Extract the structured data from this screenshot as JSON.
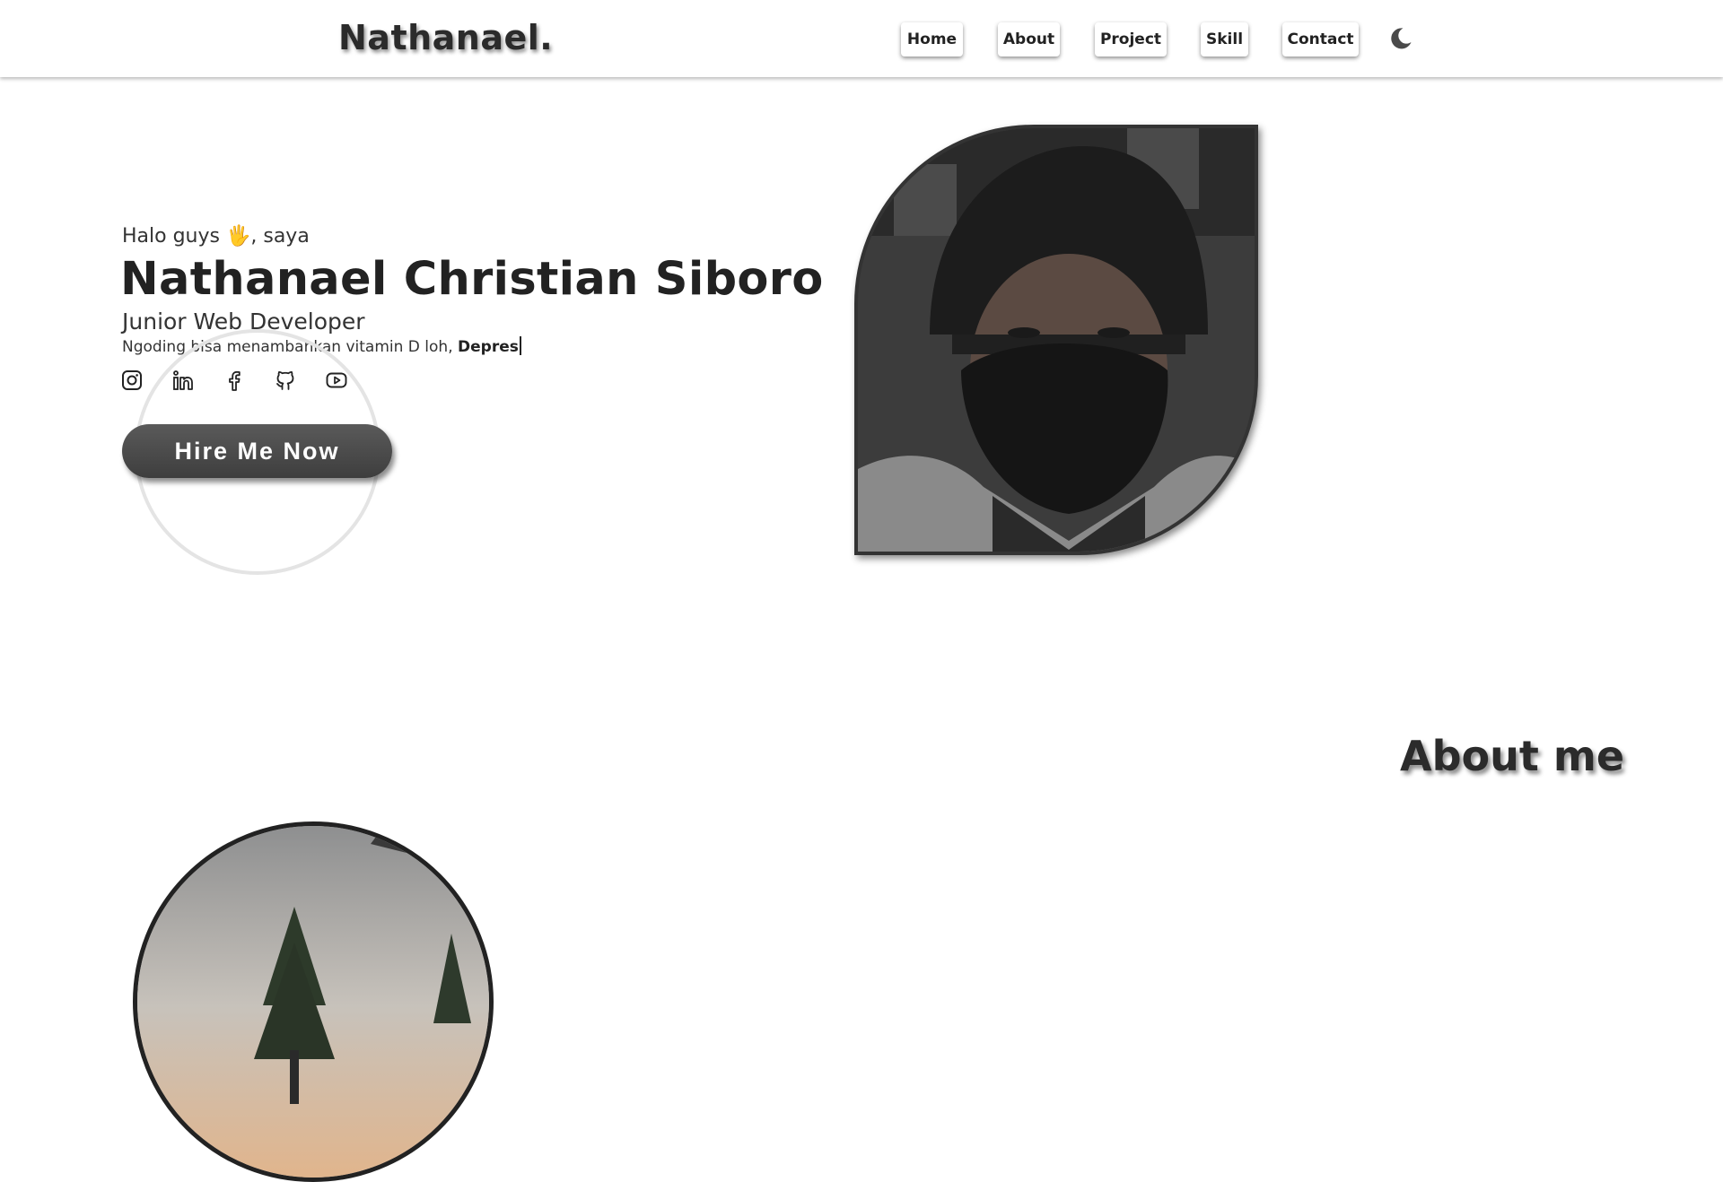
{
  "navbar": {
    "brand": "Nathanael.",
    "links": [
      {
        "label": "Home"
      },
      {
        "label": "About"
      },
      {
        "label": "Project"
      },
      {
        "label": "Skill"
      },
      {
        "label": "Contact"
      }
    ],
    "theme_icon": "moon-icon"
  },
  "hero": {
    "greeting": "Halo guys 🖐, saya",
    "name": "Nathanael Christian Siboro",
    "role": "Junior Web Developer",
    "tagline_prefix": "Ngoding bisa menambahkan vitamin D loh,",
    "tagline_typed": "Depres",
    "socials": [
      {
        "icon": "instagram-icon"
      },
      {
        "icon": "linkedin-icon"
      },
      {
        "icon": "facebook-icon"
      },
      {
        "icon": "github-icon"
      },
      {
        "icon": "youtube-icon"
      }
    ],
    "cta_label": "Hire Me Now",
    "photo_icon": "profile-photo"
  },
  "about": {
    "title": "About me",
    "photo_icon": "landscape-photo"
  },
  "colors": {
    "text": "#222222",
    "button": "#4a4a4a",
    "background": "#ffffff"
  }
}
